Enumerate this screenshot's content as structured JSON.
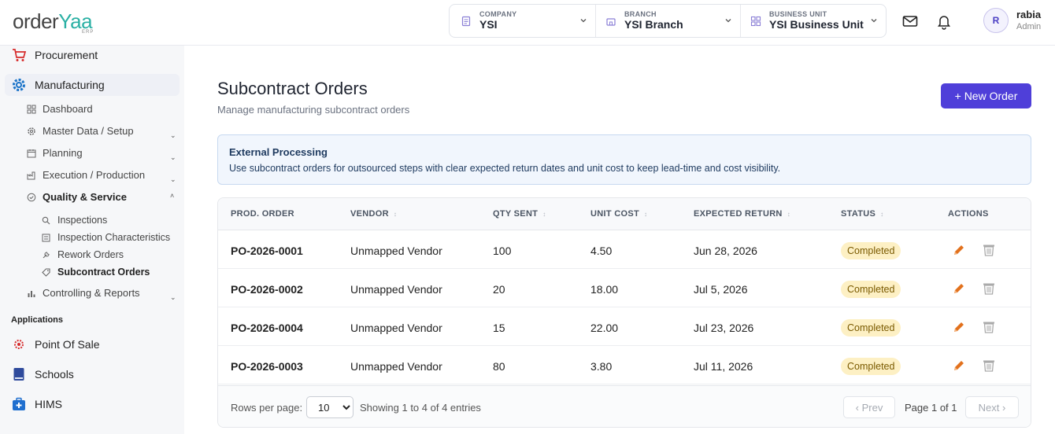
{
  "header": {
    "logo_main": "order",
    "logo_accent": "Yaa",
    "logo_sub": "ERP",
    "company": {
      "label": "COMPANY",
      "value": "YSI"
    },
    "branch": {
      "label": "BRANCH",
      "value": "YSI Branch"
    },
    "business_unit": {
      "label": "BUSINESS UNIT",
      "value": "YSI Business Unit"
    },
    "user": {
      "initial": "R",
      "name": "rabia",
      "role": "Admin"
    }
  },
  "sidebar": {
    "procurement": "Procurement",
    "manufacturing": "Manufacturing",
    "items": {
      "dashboard": "Dashboard",
      "master_data": "Master Data / Setup",
      "planning": "Planning",
      "execution": "Execution / Production",
      "quality": "Quality & Service",
      "controlling": "Controlling & Reports"
    },
    "quality_items": {
      "inspections": "Inspections",
      "characteristics": "Inspection Characteristics",
      "rework": "Rework Orders",
      "subcontract": "Subcontract Orders"
    },
    "applications_label": "Applications",
    "apps": {
      "pos": "Point Of Sale",
      "schools": "Schools",
      "hims": "HIMS"
    }
  },
  "page": {
    "title": "Subcontract Orders",
    "subtitle": "Manage manufacturing subcontract orders",
    "new_button": "+ New Order"
  },
  "info": {
    "title": "External Processing",
    "text": "Use subcontract orders for outsourced steps with clear expected return dates and unit cost to keep lead-time and cost visibility."
  },
  "table": {
    "columns": {
      "prod_order": "PROD. ORDER",
      "vendor": "VENDOR",
      "qty": "QTY SENT",
      "cost": "UNIT COST",
      "ret": "EXPECTED RETURN",
      "status": "STATUS",
      "actions": "ACTIONS"
    },
    "rows": [
      {
        "order": "PO-2026-0001",
        "vendor": "Unmapped Vendor",
        "qty": "100",
        "cost": "4.50",
        "ret": "Jun 28, 2026",
        "status": "Completed"
      },
      {
        "order": "PO-2026-0002",
        "vendor": "Unmapped Vendor",
        "qty": "20",
        "cost": "18.00",
        "ret": "Jul 5, 2026",
        "status": "Completed"
      },
      {
        "order": "PO-2026-0004",
        "vendor": "Unmapped Vendor",
        "qty": "15",
        "cost": "22.00",
        "ret": "Jul 23, 2026",
        "status": "Completed"
      },
      {
        "order": "PO-2026-0003",
        "vendor": "Unmapped Vendor",
        "qty": "80",
        "cost": "3.80",
        "ret": "Jul 11, 2026",
        "status": "Completed"
      }
    ]
  },
  "footer": {
    "rows_per_page_label": "Rows per page:",
    "rows_per_page_value": "10",
    "showing": "Showing 1 to 4 of 4 entries",
    "prev": "‹ Prev",
    "page_info": "Page 1 of 1",
    "next": "Next ›"
  },
  "colors": {
    "primary": "#4f3fd9",
    "status_completed_bg": "#fdf0c4",
    "info_bg": "#f1f6fd",
    "edit_icon": "#e2711d"
  }
}
